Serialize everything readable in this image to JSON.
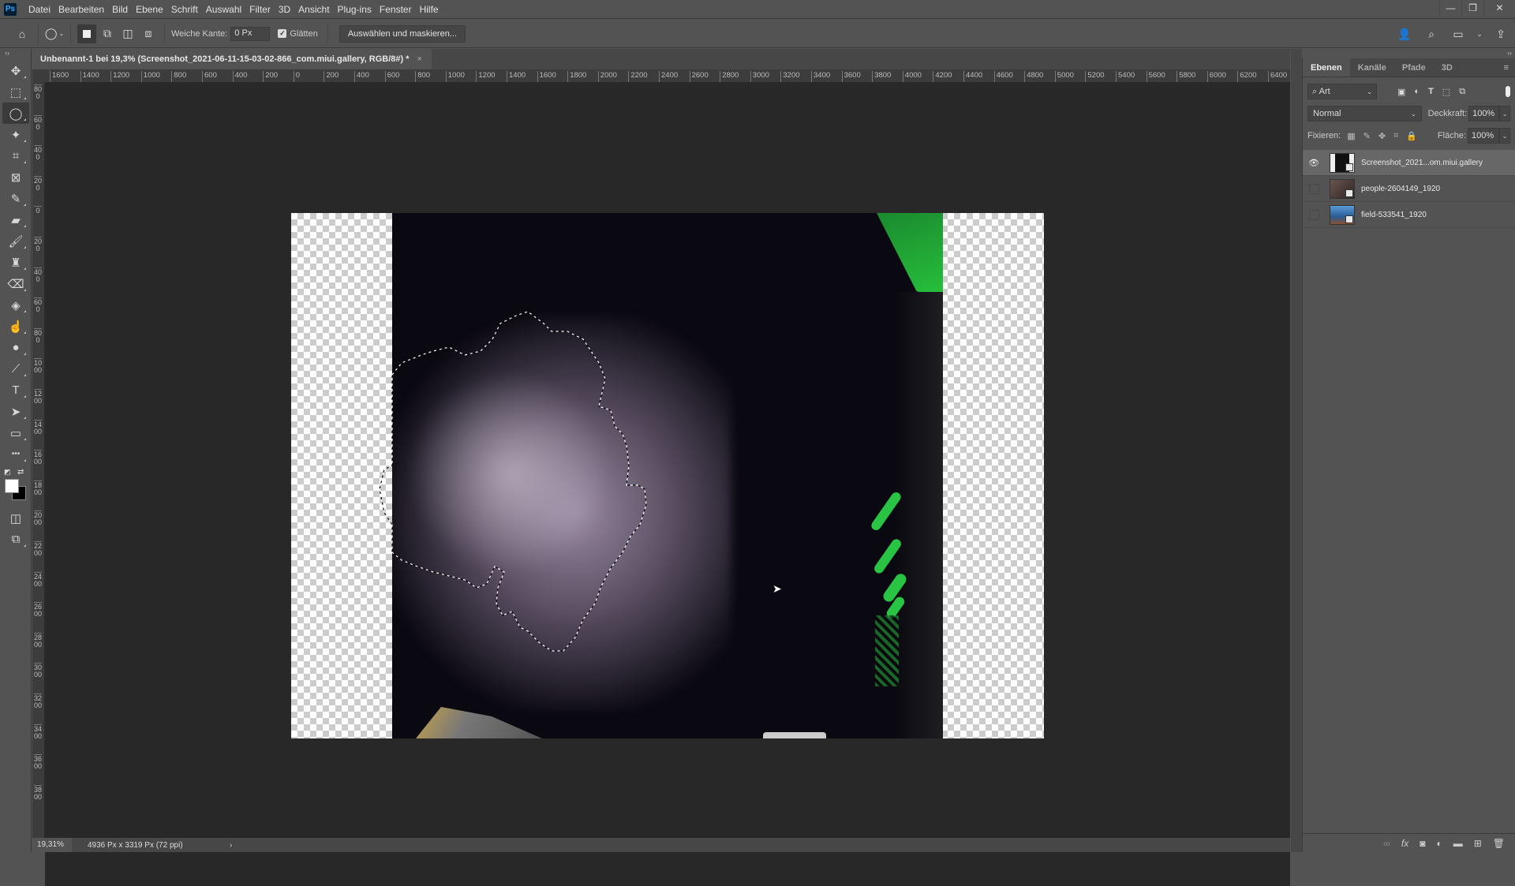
{
  "app": {
    "logo": "Ps",
    "menu": [
      "Datei",
      "Bearbeiten",
      "Bild",
      "Ebene",
      "Schrift",
      "Auswahl",
      "Filter",
      "3D",
      "Ansicht",
      "Plug-ins",
      "Fenster",
      "Hilfe"
    ],
    "window_controls": {
      "minimize": "—",
      "restore": "❐",
      "close": "✕"
    }
  },
  "options_bar": {
    "feather_label": "Weiche Kante:",
    "feather_value": "0 Px",
    "antialias_label": "Glätten",
    "antialias_checked": true,
    "select_mask_button": "Auswählen und maskieren..."
  },
  "toolbar": {
    "tools": [
      {
        "name": "move-tool",
        "glyph": "✥"
      },
      {
        "name": "marquee-tool",
        "glyph": "⬚"
      },
      {
        "name": "lasso-tool",
        "glyph": "◯",
        "active": true
      },
      {
        "name": "magic-wand-tool",
        "glyph": "✦"
      },
      {
        "name": "crop-tool",
        "glyph": "⌗"
      },
      {
        "name": "frame-tool",
        "glyph": "⊠"
      },
      {
        "name": "eyedropper-tool",
        "glyph": "✎"
      },
      {
        "name": "healing-brush-tool",
        "glyph": "▰"
      },
      {
        "name": "brush-tool",
        "glyph": "🖌"
      },
      {
        "name": "clone-stamp-tool",
        "glyph": "♜"
      },
      {
        "name": "eraser-tool",
        "glyph": "⌫"
      },
      {
        "name": "paint-bucket-tool",
        "glyph": "◈"
      },
      {
        "name": "smudge-tool",
        "glyph": "☝"
      },
      {
        "name": "dodge-tool",
        "glyph": "●"
      },
      {
        "name": "pen-tool",
        "glyph": "⟋"
      },
      {
        "name": "type-tool",
        "glyph": "T"
      },
      {
        "name": "path-selection-tool",
        "glyph": "➤"
      },
      {
        "name": "rectangle-tool",
        "glyph": "▭"
      },
      {
        "name": "more-tools",
        "glyph": "•••"
      }
    ],
    "foreground_color": "#ffffff",
    "background_color": "#000000"
  },
  "document": {
    "tab_title": "Unbenannt-1 bei 19,3% (Screenshot_2021-06-11-15-03-02-866_com.miui.gallery, RGB/8#) *",
    "tab_close": "×",
    "ruler_h": [
      "1600",
      "1400",
      "1200",
      "1000",
      "800",
      "600",
      "400",
      "200",
      "0",
      "200",
      "400",
      "600",
      "800",
      "1000",
      "1200",
      "1400",
      "1600",
      "1800",
      "2000",
      "2200",
      "2400",
      "2600",
      "2800",
      "3000",
      "3200",
      "3400",
      "3600",
      "3800",
      "4000",
      "4200",
      "4400",
      "4600",
      "4800",
      "5000",
      "5200",
      "5400",
      "5600",
      "5800",
      "6000",
      "6200",
      "6400"
    ],
    "ruler_v": [
      "800",
      "600",
      "400",
      "200",
      "0",
      "200",
      "400",
      "600",
      "800",
      "1000",
      "1200",
      "1400",
      "1600",
      "1800",
      "2000",
      "2200",
      "2400",
      "2600",
      "2800",
      "3000",
      "3200",
      "3400",
      "3600",
      "3800"
    ]
  },
  "status": {
    "zoom": "19,31%",
    "doc_size": "4936 Px x 3319 Px (72 ppi)",
    "arrow": "›"
  },
  "layers_panel": {
    "tabs": [
      "Ebenen",
      "Kanäle",
      "Pfade",
      "3D"
    ],
    "active_tab": "Ebenen",
    "filter_kind": "Art",
    "blend_mode": "Normal",
    "opacity_label": "Deckkraft:",
    "opacity": "100%",
    "lock_label": "Fixieren:",
    "fill_label": "Fläche:",
    "fill": "100%",
    "layers": [
      {
        "name": "Screenshot_2021...om.miui.gallery",
        "visible": true,
        "selected": true,
        "thumb": "#1a1a1a"
      },
      {
        "name": "people-2604149_1920",
        "visible": false,
        "selected": false,
        "thumb": "#5a4a44"
      },
      {
        "name": "field-533541_1920",
        "visible": false,
        "selected": false,
        "thumb": "#3c78b4"
      }
    ]
  },
  "colors": {
    "chrome": "#535353",
    "canvas_bg": "#282828",
    "accent_green": "#29c444"
  }
}
